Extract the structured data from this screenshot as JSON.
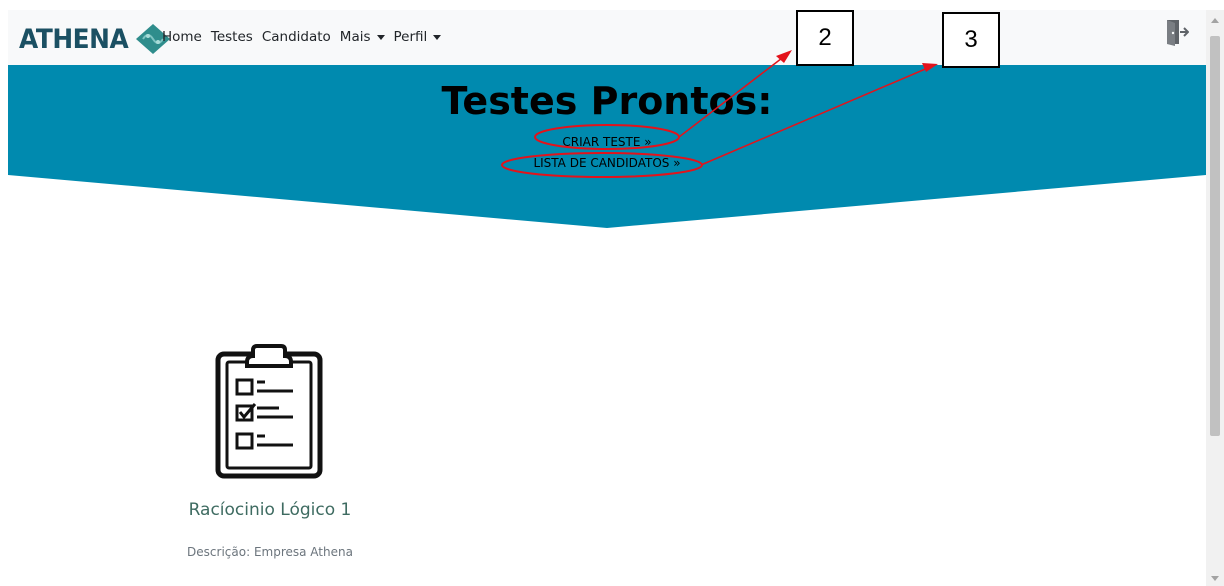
{
  "navbar": {
    "brand": "ATHENA",
    "links": [
      "Home",
      "Testes",
      "Candidato"
    ],
    "dropdowns": [
      "Mais",
      "Perfil"
    ],
    "logout_icon": "logout-door-icon"
  },
  "hero": {
    "title": "Testes Prontos:",
    "create_test_link": "CRIAR TESTE »",
    "candidates_link": "LISTA DE CANDIDATOS »"
  },
  "annotations": {
    "label_2": "2",
    "label_3": "3",
    "color": "#e3131b"
  },
  "tests": [
    {
      "icon": "clipboard-checklist-icon",
      "title": "Racíocinio Lógico 1",
      "description": "Descrição: Empresa Athena"
    }
  ],
  "colors": {
    "hero_bg": "#008aaf",
    "brand": "#1b5063",
    "navbar_bg": "#f8f9fa",
    "card_title": "#3e6b61"
  }
}
